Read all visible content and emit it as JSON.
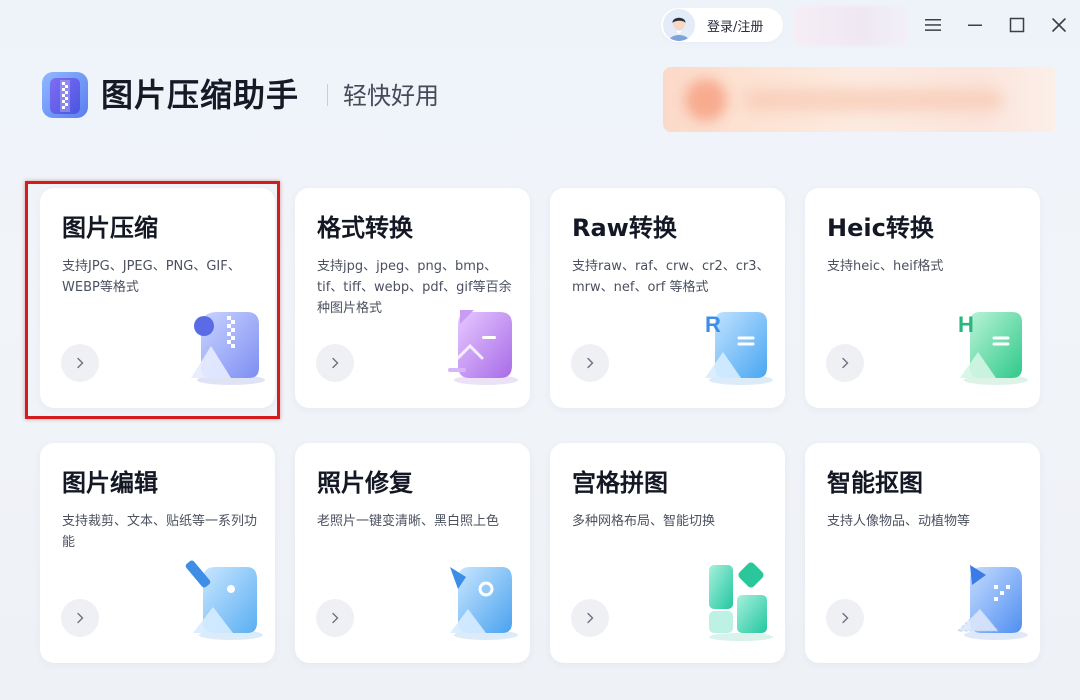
{
  "titlebar": {
    "login_label": "登录/注册"
  },
  "header": {
    "app_title": "图片压缩助手",
    "slogan": "轻快好用"
  },
  "cards": [
    {
      "title": "图片压缩",
      "desc": "支持JPG、JPEG、PNG、GIF、WEBP等格式"
    },
    {
      "title": "格式转换",
      "desc": "支持jpg、jpeg、png、bmp、tif、tiff、webp、pdf、gif等百余种图片格式"
    },
    {
      "title": "Raw转换",
      "desc": "支持raw、raf、crw、cr2、cr3、mrw、nef、orf 等格式"
    },
    {
      "title": "Heic转换",
      "desc": "支持heic、heif格式"
    },
    {
      "title": "图片编辑",
      "desc": "支持裁剪、文本、贴纸等一系列功能"
    },
    {
      "title": "照片修复",
      "desc": "老照片一键变清晰、黑白照上色"
    },
    {
      "title": "宫格拼图",
      "desc": "多种网格布局、智能切换"
    },
    {
      "title": "智能抠图",
      "desc": "支持人像物品、动植物等"
    }
  ],
  "icons": {
    "menu": "menu-icon",
    "minimize": "minimize-icon",
    "maximize": "maximize-icon",
    "close": "close-icon",
    "arrow": "chevron-right-icon"
  },
  "colors": {
    "selection": "#d51c1c",
    "compress": "#7b8cf0",
    "format": "#b57af0",
    "raw": "#5fb0f4",
    "heic": "#45d49a",
    "edit": "#5fb4f4",
    "repair": "#5fb4f4",
    "grid": "#3fd6b0",
    "cutout": "#5f9cf4"
  }
}
